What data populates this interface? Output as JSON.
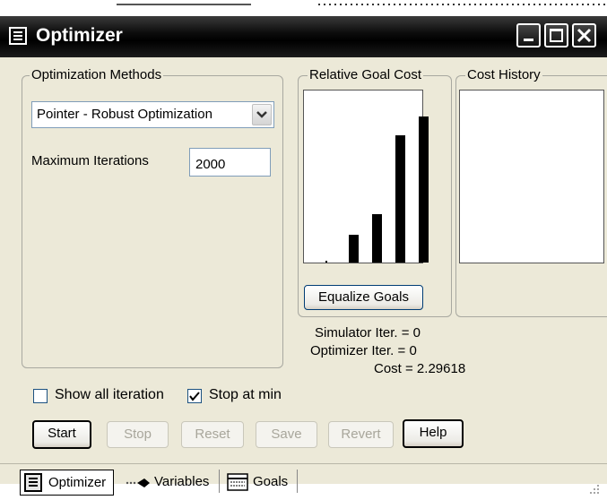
{
  "window": {
    "title": "Optimizer"
  },
  "methods": {
    "group_label": "Optimization Methods",
    "selected_method": "Pointer - Robust Optimization",
    "max_iter_label": "Maximum Iterations",
    "max_iter_value": "2000"
  },
  "goal_cost": {
    "group_label": "Relative Goal Cost",
    "bar_values": [
      1,
      16,
      28,
      74,
      85
    ],
    "equalize_label": "Equalize Goals"
  },
  "history": {
    "group_label": "Cost History"
  },
  "stats": {
    "simulator": "Simulator Iter. = 0",
    "optimizer": "Optimizer  Iter. = 0",
    "cost": "Cost = 2.29618"
  },
  "options": {
    "show_all_label": "Show all iteration",
    "show_all_checked": false,
    "stop_at_min_label": "Stop at min",
    "stop_at_min_checked": true
  },
  "buttons": {
    "start": "Start",
    "stop": "Stop",
    "reset": "Reset",
    "save": "Save",
    "revert": "Revert",
    "help": "Help"
  },
  "tabs": [
    {
      "label": "Optimizer"
    },
    {
      "label": "Variables"
    },
    {
      "label": "Goals"
    }
  ],
  "colors": {
    "title_bar": "#000000",
    "dialog_bg": "#ece9d8",
    "bars": "#000000"
  }
}
